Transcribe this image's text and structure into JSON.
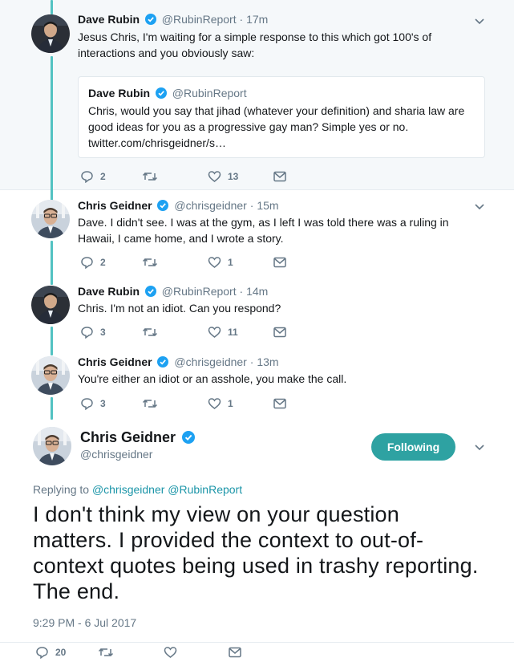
{
  "thread": [
    {
      "name": "Dave Rubin",
      "handle": "@RubinReport",
      "time": "17m",
      "text": "Jesus Chris, I'm waiting for a simple response to this which got 100's of interactions and you obviously saw:",
      "quote": {
        "name": "Dave Rubin",
        "handle": "@RubinReport",
        "text": "Chris, would you say that jihad (whatever your definition) and sharia law are good ideas for you as a progressive gay man? Simple yes or no. twitter.com/chrisgeidner/s…"
      },
      "replies": "2",
      "retweets": "",
      "likes": "13"
    },
    {
      "name": "Chris Geidner",
      "handle": "@chrisgeidner",
      "time": "15m",
      "text": "Dave. I didn't see. I was at the gym, as I left I was told there was a ruling in Hawaii, I came home, and I wrote a story.",
      "replies": "2",
      "retweets": "",
      "likes": "1"
    },
    {
      "name": "Dave Rubin",
      "handle": "@RubinReport",
      "time": "14m",
      "text": "Chris. I'm not an idiot. Can you respond?",
      "replies": "3",
      "retweets": "",
      "likes": "11"
    },
    {
      "name": "Chris Geidner",
      "handle": "@chrisgeidner",
      "time": "13m",
      "text": "You're either an idiot or an asshole, you make the call.",
      "replies": "3",
      "retweets": "",
      "likes": "1"
    }
  ],
  "main": {
    "name": "Chris Geidner",
    "handle": "@chrisgeidner",
    "follow_label": "Following",
    "replying_prefix": "Replying to",
    "replying_to": "@chrisgeidner @RubinReport",
    "text": "I don't think my view on your question matters. I provided the context to out-of-context quotes being used in trashy reporting. The end.",
    "timestamp": "9:29 PM - 6 Jul 2017",
    "replies": "20",
    "retweets": "",
    "likes": ""
  },
  "separator": "·",
  "colors": {
    "thread_line": "#52c2c2",
    "follow_button": "#2ea2a2",
    "verified": "#1da1f2",
    "mention": "#1b95a8",
    "muted": "#657786"
  },
  "icons": [
    "reply-icon",
    "retweet-icon",
    "like-icon",
    "direct-message-icon",
    "verified-badge-icon",
    "chevron-down-icon"
  ]
}
